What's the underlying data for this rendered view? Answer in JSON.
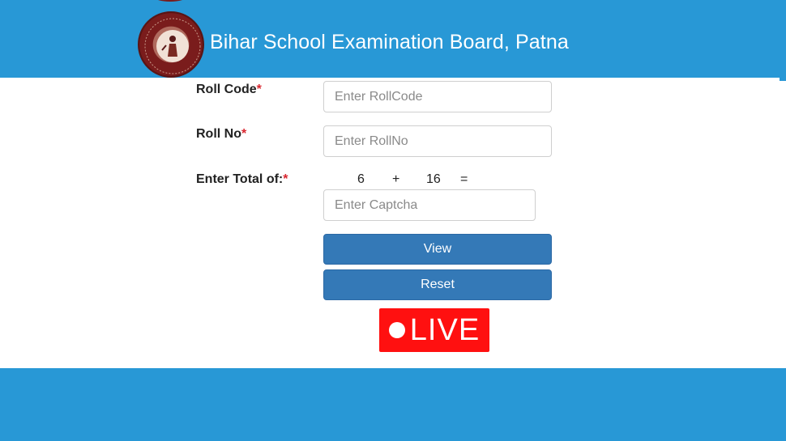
{
  "header": {
    "title": "Bihar School Examination Board, Patna",
    "logo": "bseb-seal-logo",
    "bg_color": "#2898d6"
  },
  "form": {
    "roll_code": {
      "label": "Roll Code",
      "required_mark": "*",
      "placeholder": "Enter RollCode",
      "value": ""
    },
    "roll_no": {
      "label": "Roll No",
      "required_mark": "*",
      "placeholder": "Enter RollNo",
      "value": ""
    },
    "captcha": {
      "label": "Enter Total of:",
      "required_mark": "*",
      "operand_a": "6",
      "operator": "+",
      "operand_b": "16",
      "equals": "=",
      "placeholder": "Enter Captcha",
      "value": ""
    },
    "view_button": "View",
    "reset_button": "Reset",
    "button_color": "#3479b7"
  },
  "live_badge": {
    "text": "LIVE",
    "color": "#ff1010"
  }
}
